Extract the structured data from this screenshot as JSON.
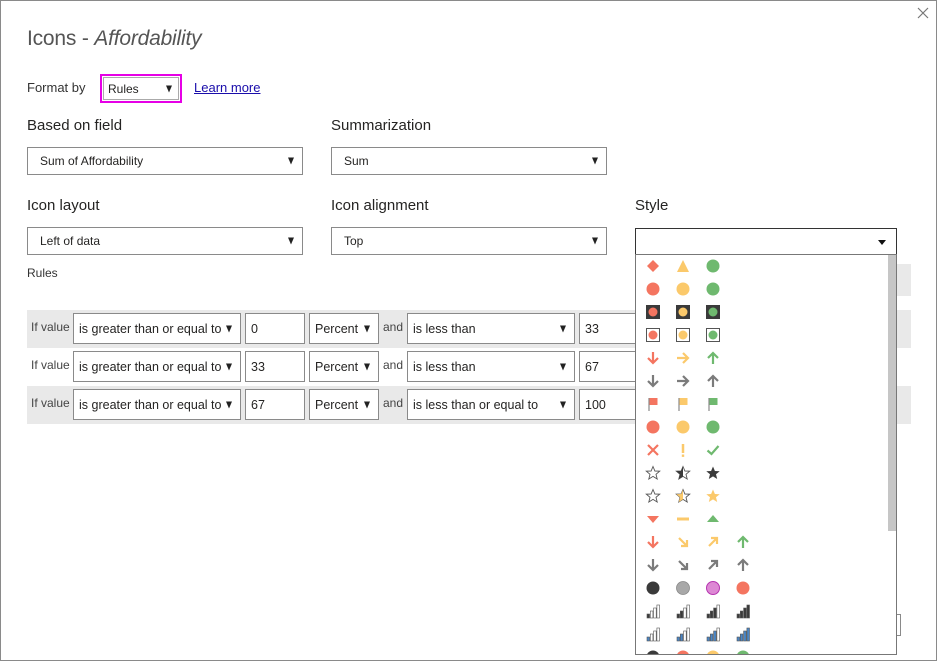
{
  "dialog": {
    "title_prefix": "Icons - ",
    "title_field": "Affordability",
    "close_icon": "close-icon"
  },
  "format_by": {
    "label": "Format by",
    "value": "Rules",
    "learn_more": "Learn more"
  },
  "based_on_field": {
    "label": "Based on field",
    "value": "Sum of Affordability"
  },
  "summarization": {
    "label": "Summarization",
    "value": "Sum"
  },
  "icon_layout": {
    "label": "Icon layout",
    "value": "Left of data"
  },
  "icon_alignment": {
    "label": "Icon alignment",
    "value": "Top"
  },
  "style": {
    "label": "Style",
    "selected": [
      "diamond-red",
      "triangle-yellow",
      "circle-green"
    ],
    "options": [
      [
        "diamond-red",
        "triangle-yellow",
        "circle-green"
      ],
      [
        "circle-red",
        "circle-yellow",
        "circle-green"
      ],
      [
        "traffic-light-red",
        "traffic-light-yellow",
        "traffic-light-green"
      ],
      [
        "framed-circle-red",
        "framed-circle-yellow",
        "framed-circle-green"
      ],
      [
        "arrow-down-red",
        "arrow-right-yellow",
        "arrow-up-green"
      ],
      [
        "arrow-down-gray",
        "arrow-right-gray",
        "arrow-up-gray"
      ],
      [
        "flag-red",
        "flag-yellow",
        "flag-green"
      ],
      [
        "circled-x-red",
        "circled-exclamation-yellow",
        "circled-check-green"
      ],
      [
        "x-red",
        "exclamation-yellow",
        "check-green"
      ],
      [
        "star-empty",
        "star-half-dark",
        "star-full-dark"
      ],
      [
        "star-empty",
        "star-half-gold",
        "star-full-gold"
      ],
      [
        "triangle-down-red",
        "dash-yellow",
        "triangle-up-green"
      ],
      [
        "arrow-down-red",
        "arrow-down-right-yellow",
        "arrow-up-right-yellow",
        "arrow-up-green"
      ],
      [
        "arrow-down-gray",
        "arrow-down-right-gray",
        "arrow-up-right-gray",
        "arrow-up-gray"
      ],
      [
        "circle-black",
        "circle-gray",
        "circle-pink",
        "circle-red"
      ],
      [
        "bars-1-dark",
        "bars-2-dark",
        "bars-3-dark",
        "bars-4-dark"
      ],
      [
        "bars-1-blue",
        "bars-2-blue",
        "bars-3-blue",
        "bars-4-blue"
      ],
      [
        "circle-black",
        "circle-red",
        "circle-yellow",
        "circle-green"
      ]
    ]
  },
  "rules": {
    "label": "Rules",
    "rows": [
      {
        "if_label": "If value",
        "op1": "is greater than or equal to",
        "v1": "0",
        "unit": "Percent",
        "and_label": "and",
        "op2": "is less than",
        "v2": "33"
      },
      {
        "if_label": "If value",
        "op1": "is greater than or equal to",
        "v1": "33",
        "unit": "Percent",
        "and_label": "and",
        "op2": "is less than",
        "v2": "67"
      },
      {
        "if_label": "If value",
        "op1": "is greater than or equal to",
        "v1": "67",
        "unit": "Percent",
        "and_label": "and",
        "op2": "is less than or equal to",
        "v2": "100"
      }
    ]
  },
  "colors": {
    "red": "#f47560",
    "yellow": "#fbc96b",
    "green": "#6fb96f",
    "gray": "#7b7b7b",
    "dark": "#3a3a3a",
    "highlight": "#e600e6",
    "link": "#1a0dab"
  }
}
